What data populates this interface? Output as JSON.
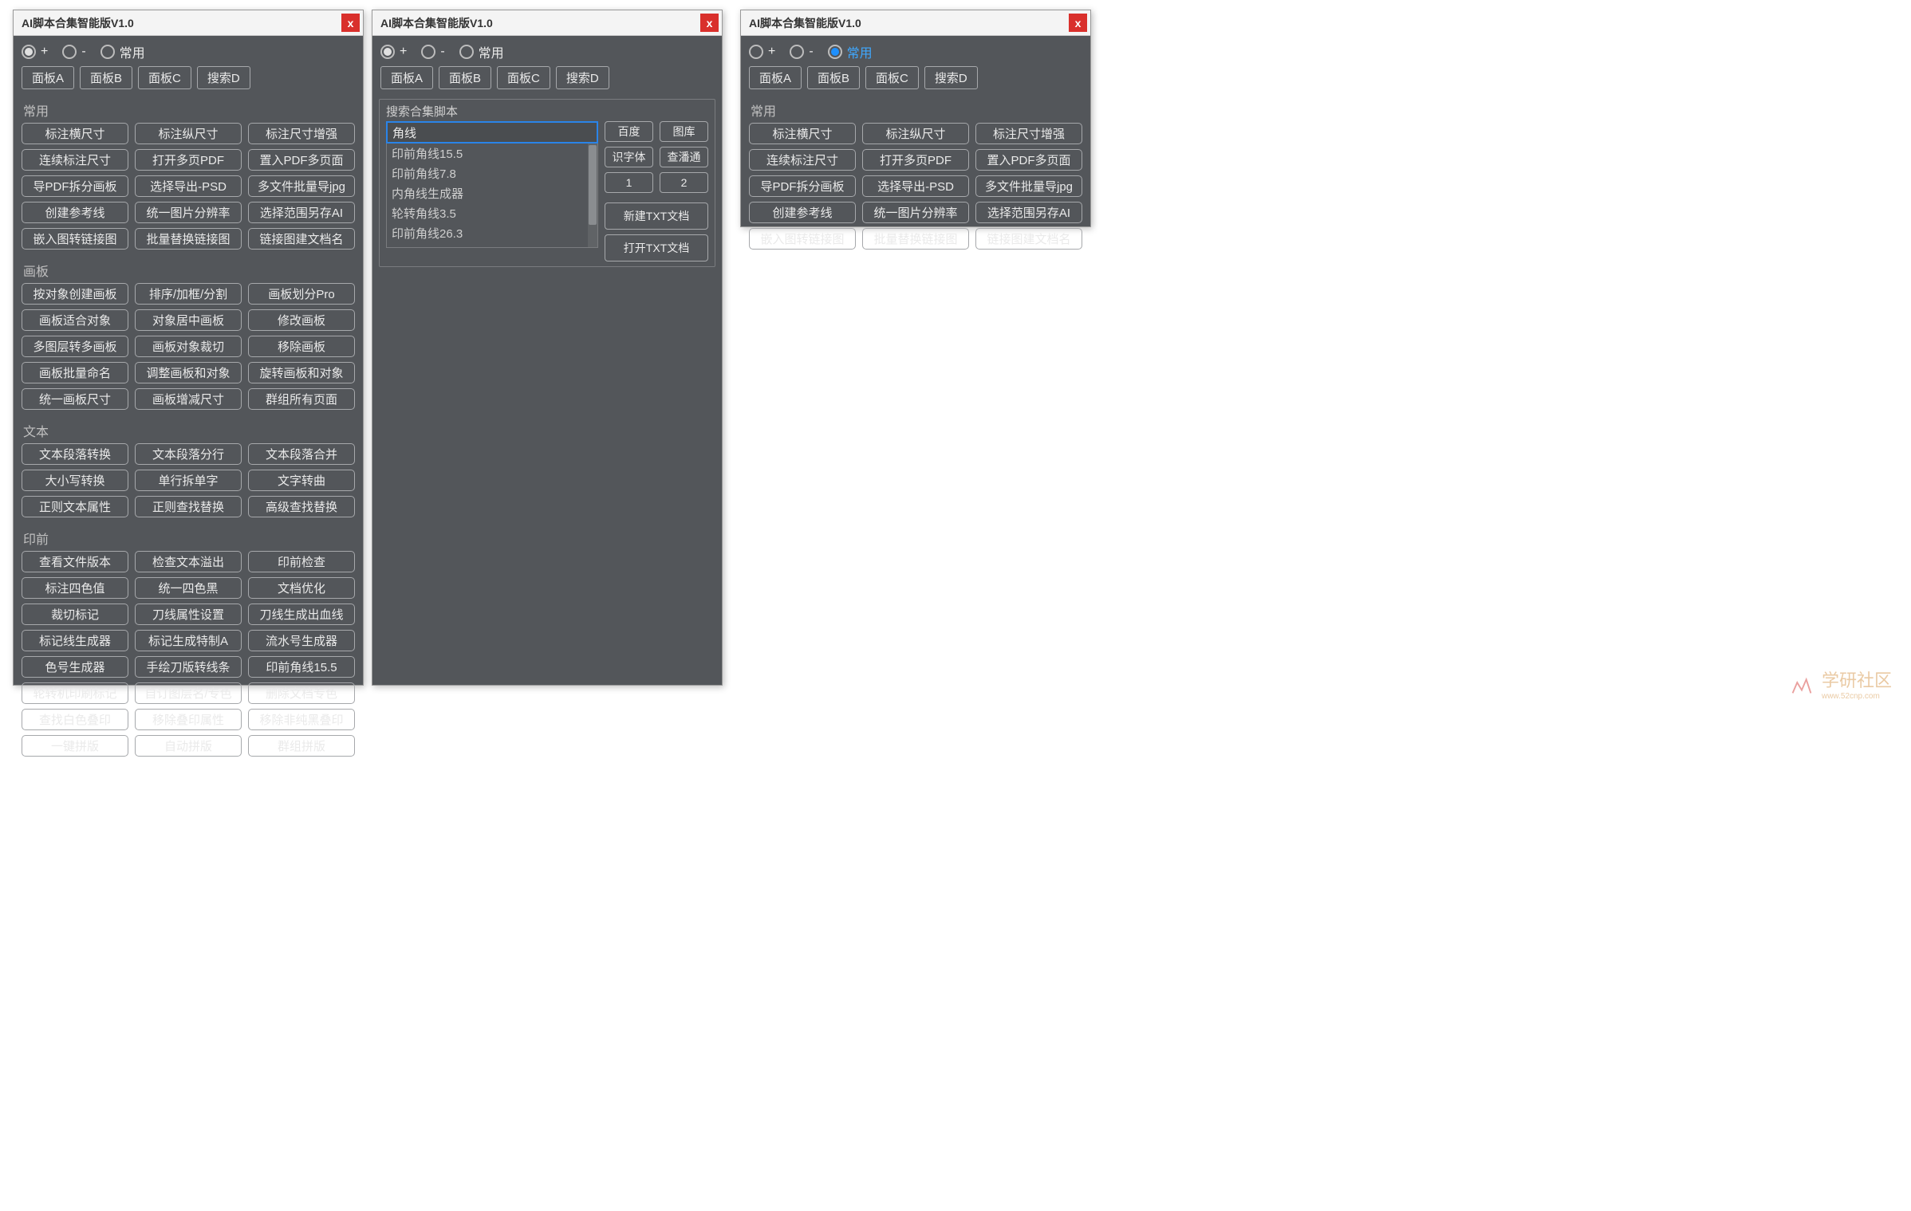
{
  "app_title": "AI脚本合集智能版V1.0",
  "close_x": "x",
  "modes": {
    "plus": "+",
    "minus": "-",
    "fav": "常用"
  },
  "tabs": [
    "面板A",
    "面板B",
    "面板C",
    "搜索D"
  ],
  "panel1": {
    "groups": [
      {
        "label": "常用",
        "buttons": [
          "标注横尺寸",
          "标注纵尺寸",
          "标注尺寸增强",
          "连续标注尺寸",
          "打开多页PDF",
          "置入PDF多页面",
          "导PDF拆分画板",
          "选择导出-PSD",
          "多文件批量导jpg",
          "创建参考线",
          "统一图片分辨率",
          "选择范围另存AI",
          "嵌入图转链接图",
          "批量替换链接图",
          "链接图建文档名"
        ]
      },
      {
        "label": "画板",
        "buttons": [
          "按对象创建画板",
          "排序/加框/分割",
          "画板划分Pro",
          "画板适合对象",
          "对象居中画板",
          "修改画板",
          "多图层转多画板",
          "画板对象裁切",
          "移除画板",
          "画板批量命名",
          "调整画板和对象",
          "旋转画板和对象",
          "统一画板尺寸",
          "画板增减尺寸",
          "群组所有页面"
        ]
      },
      {
        "label": "文本",
        "buttons": [
          "文本段落转换",
          "文本段落分行",
          "文本段落合并",
          "大小写转换",
          "单行拆单字",
          "文字转曲",
          "正则文本属性",
          "正则查找替换",
          "高级查找替换"
        ]
      },
      {
        "label": "印前",
        "buttons": [
          "查看文件版本",
          "检查文本溢出",
          "印前检查",
          "标注四色值",
          "统一四色黑",
          "文档优化",
          "裁切标记",
          "刀线属性设置",
          "刀线生成出血线",
          "标记线生成器",
          "标记生成特制A",
          "流水号生成器",
          "色号生成器",
          "手绘刀版转线条",
          "印前角线15.5",
          "轮转机印刷标记",
          "自订图层名/专色",
          "删除文档专色",
          "查找白色叠印",
          "移除叠印属性",
          "移除非纯黑叠印",
          "一键拼版",
          "自动拼版",
          "群组拼版"
        ]
      }
    ]
  },
  "panel2": {
    "search_title": "搜索合集脚本",
    "search_value": "角线",
    "results": [
      "印前角线15.5",
      "印前角线7.8",
      "内角线生成器",
      "轮转角线3.5",
      "印前角线26.3"
    ],
    "side_buttons_row1": [
      "百度",
      "图库"
    ],
    "side_buttons_row2": [
      "识字体",
      "查潘通"
    ],
    "side_buttons_row3": [
      "1",
      "2"
    ],
    "side_buttons_wide": [
      "新建TXT文档",
      "打开TXT文档"
    ]
  },
  "panel3": {
    "groups": [
      {
        "label": "常用",
        "buttons": [
          "标注横尺寸",
          "标注纵尺寸",
          "标注尺寸增强",
          "连续标注尺寸",
          "打开多页PDF",
          "置入PDF多页面",
          "导PDF拆分画板",
          "选择导出-PSD",
          "多文件批量导jpg",
          "创建参考线",
          "统一图片分辨率",
          "选择范围另存AI",
          "嵌入图转链接图",
          "批量替换链接图",
          "链接图建文档名"
        ]
      }
    ]
  },
  "watermark": {
    "text": "学研社区",
    "url": "www.52cnp.com"
  }
}
